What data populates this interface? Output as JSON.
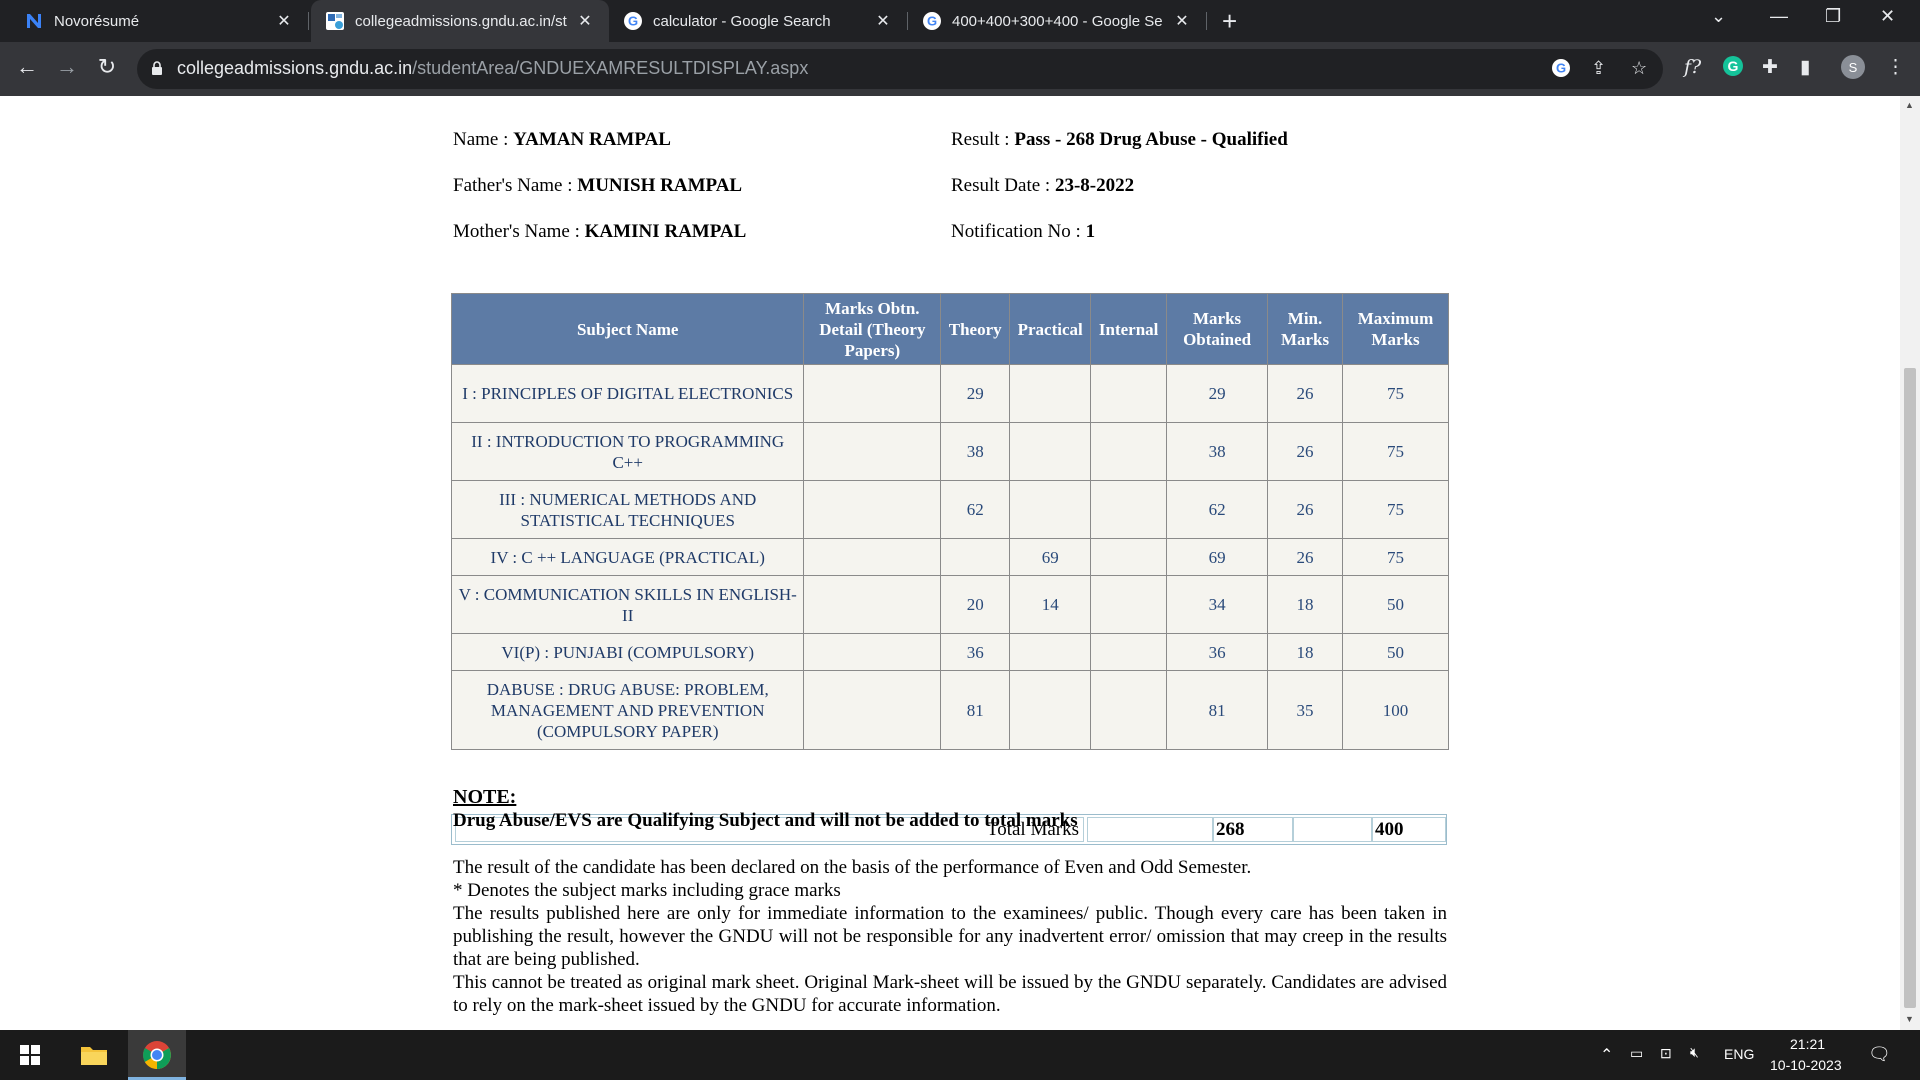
{
  "browser": {
    "tabs": [
      {
        "title": "Novorésumé",
        "favicon": "novoresume-icon"
      },
      {
        "title": "collegeadmissions.gndu.ac.in/st",
        "favicon": "gndu-icon",
        "active": true
      },
      {
        "title": "calculator - Google Search",
        "favicon": "google-icon"
      },
      {
        "title": "400+400+300+400 - Google Se",
        "favicon": "google-icon"
      }
    ],
    "url_domain": "collegeadmissions.gndu.ac.in",
    "url_path": "/studentArea/GNDUEXAMRESULTDISPLAY.aspx",
    "profile_initial": "S"
  },
  "student": {
    "name_label": "Name : ",
    "name": "YAMAN RAMPAL",
    "father_label": "Father's Name : ",
    "father": "MUNISH RAMPAL",
    "mother_label": "Mother's Name : ",
    "mother": "KAMINI RAMPAL",
    "result_label": "Result : ",
    "result": "Pass - 268 Drug Abuse - Qualified",
    "date_label": "Result Date : ",
    "date": "23-8-2022",
    "notif_label": "Notification No : ",
    "notif": "1"
  },
  "table": {
    "headers": [
      "Subject Name",
      "Marks Obtn. Detail (Theory Papers)",
      "Theory",
      "Practical",
      "Internal",
      "Marks Obtained",
      "Min. Marks",
      "Maximum Marks"
    ],
    "rows": [
      {
        "subject": "I : PRINCIPLES OF DIGITAL ELECTRONICS",
        "detail": "",
        "theory": "29",
        "practical": "",
        "internal": "",
        "obtained": "29",
        "min": "26",
        "max": "75"
      },
      {
        "subject": "II : INTRODUCTION TO PROGRAMMING C++",
        "detail": "",
        "theory": "38",
        "practical": "",
        "internal": "",
        "obtained": "38",
        "min": "26",
        "max": "75"
      },
      {
        "subject": "III : NUMERICAL METHODS AND STATISTICAL TECHNIQUES",
        "detail": "",
        "theory": "62",
        "practical": "",
        "internal": "",
        "obtained": "62",
        "min": "26",
        "max": "75"
      },
      {
        "subject": "IV : C ++ LANGUAGE (PRACTICAL)",
        "detail": "",
        "theory": "",
        "practical": "69",
        "internal": "",
        "obtained": "69",
        "min": "26",
        "max": "75"
      },
      {
        "subject": "V : COMMUNICATION SKILLS IN ENGLISH-II",
        "detail": "",
        "theory": "20",
        "practical": "14",
        "internal": "",
        "obtained": "34",
        "min": "18",
        "max": "50"
      },
      {
        "subject": "VI(P) : PUNJABI (COMPULSORY)",
        "detail": "",
        "theory": "36",
        "practical": "",
        "internal": "",
        "obtained": "36",
        "min": "18",
        "max": "50"
      },
      {
        "subject": "DABUSE : DRUG ABUSE: PROBLEM, MANAGEMENT AND PREVENTION (COMPULSORY PAPER)",
        "detail": "",
        "theory": "81",
        "practical": "",
        "internal": "",
        "obtained": "81",
        "min": "35",
        "max": "100"
      }
    ],
    "total_label": "Total Marks",
    "total_obtained": "268",
    "total_max": "400"
  },
  "notes": {
    "heading": "NOTE:",
    "bold_line": "Drug Abuse/EVS are Qualifying Subject and will not be added to total marks",
    "p1": "The result of the candidate has been declared on the basis of the performance of Even and Odd Semester.",
    "p2": "* Denotes the subject marks including grace marks",
    "p3": "The results published here are only for immediate information to the examinees/ public. Though every care has been taken in publishing the result, however the GNDU will not be responsible for any inadvertent error/ omission that may creep in the results that are being published.",
    "p4": "This cannot be treated as original mark sheet. Original Mark-sheet will be issued by the GNDU separately. Candidates are advised to rely on the mark-sheet issued by the GNDU for accurate information."
  },
  "taskbar": {
    "lang": "ENG",
    "time": "21:21",
    "date": "10-10-2023"
  }
}
